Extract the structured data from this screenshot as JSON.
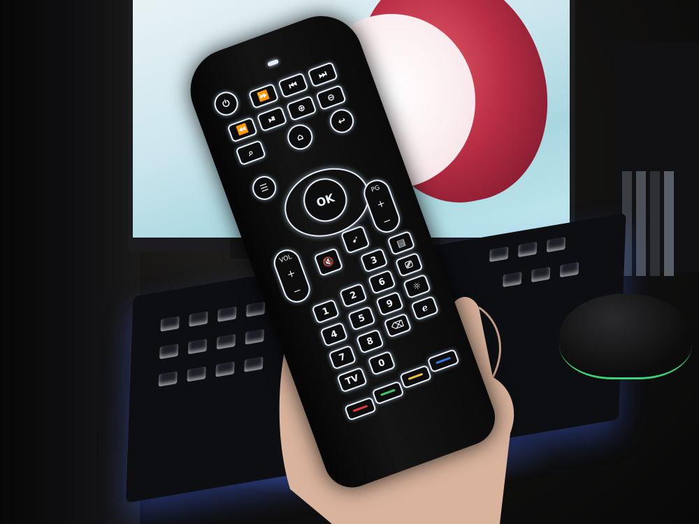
{
  "photo": {
    "subject": "tv-remote-held-in-hand",
    "remote": {
      "ok_label": "OK",
      "vol_label": "VOL",
      "pg_label": "PG",
      "tv_label": "TV",
      "digits": [
        "1",
        "2",
        "3",
        "4",
        "5",
        "6",
        "7",
        "8",
        "9",
        "0"
      ],
      "plus": "+",
      "minus": "−",
      "icons": [
        "power-icon",
        "rewind-icon",
        "fast-forward-icon",
        "prev-track-icon",
        "next-track-icon",
        "zoom-in-icon",
        "zoom-out-icon",
        "search-icon",
        "play-pause-icon",
        "home-icon",
        "back-icon",
        "menu-icon",
        "mute-icon",
        "mouse-icon",
        "subtitle-icon",
        "input-icon",
        "brightness-icon",
        "delete-icon",
        "browser-icon"
      ],
      "color_buttons": [
        "#e03a3a",
        "#3fcf6a",
        "#f2c43a",
        "#3a78e0"
      ]
    }
  }
}
